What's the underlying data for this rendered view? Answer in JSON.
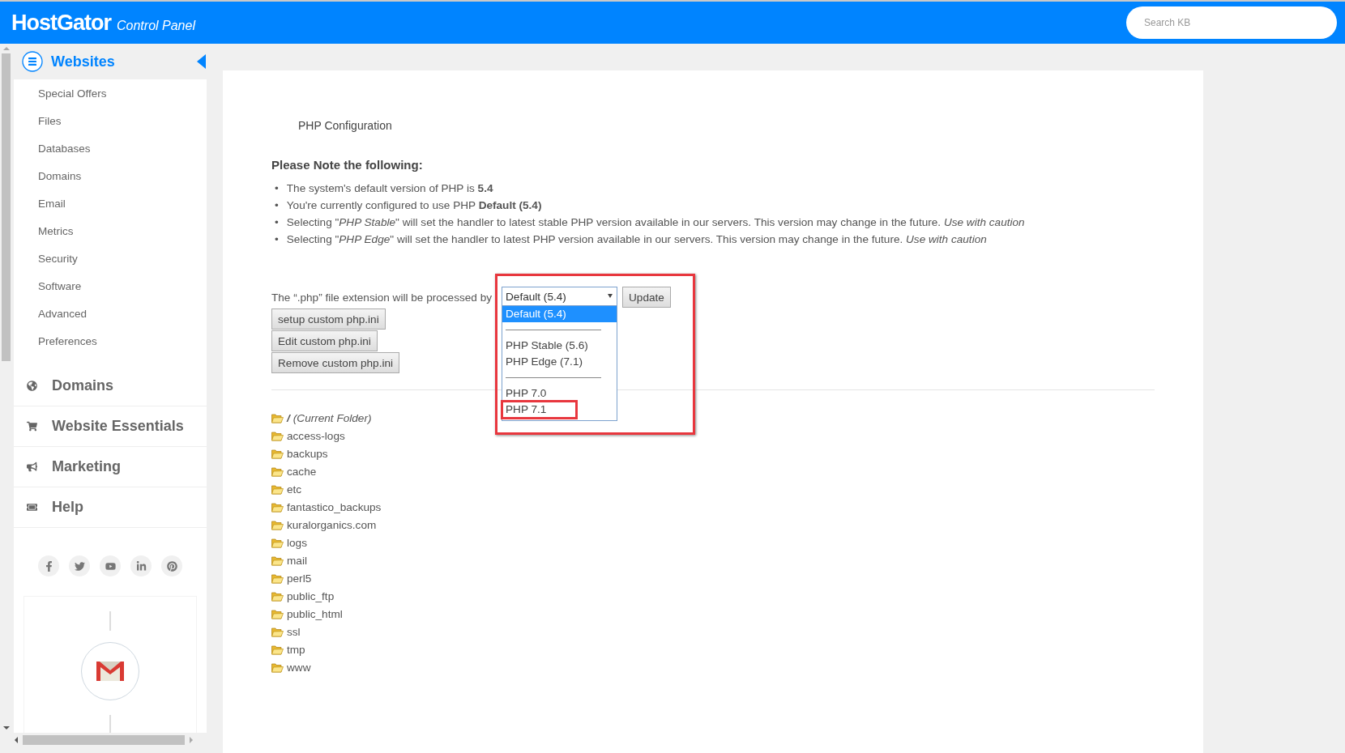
{
  "header": {
    "brand": "HostGator",
    "subtitle": "Control Panel",
    "search": {
      "placeholder": "Search KB"
    }
  },
  "sidebar": {
    "section": {
      "title": "Websites",
      "expanded": true
    },
    "items": [
      "Special Offers",
      "Files",
      "Databases",
      "Domains",
      "Email",
      "Metrics",
      "Security",
      "Software",
      "Advanced",
      "Preferences"
    ],
    "groups": [
      {
        "kind": "globe",
        "label": "Domains"
      },
      {
        "kind": "cart",
        "label": "Website Essentials"
      },
      {
        "kind": "bullhorn",
        "label": "Marketing"
      },
      {
        "kind": "ticket",
        "label": "Help"
      }
    ],
    "social": [
      {
        "kind": "facebook"
      },
      {
        "kind": "twitter"
      },
      {
        "kind": "youtube"
      },
      {
        "kind": "linkedin"
      },
      {
        "kind": "pinterest"
      }
    ]
  },
  "main": {
    "title": "PHP Configuration",
    "note_heading": "Please Note the following:",
    "notes": [
      {
        "bullet": "•",
        "text": "The system's default version of PHP is **5.4**"
      },
      {
        "bullet": "•",
        "text": "You're currently configured to use PHP **Default (5.4)**"
      },
      {
        "bullet": "•",
        "text": "Selecting \"*PHP Stable*\" will set the handler to latest stable PHP version available in our servers. This version may change in the future. *Use with caution*"
      },
      {
        "bullet": "•",
        "text": "Selecting \"*PHP Edge*\" will set the handler to latest PHP version available in our servers. This version may change in the future. *Use with caution*"
      }
    ],
    "handler": {
      "label": "The “.php” file extension will be processed by",
      "value": "Default (5.4)",
      "highlighted": true,
      "expanded": true,
      "options": [
        {
          "kind": "option",
          "label": "Default (5.4)",
          "selected": true,
          "highlighted": false
        },
        {
          "kind": "separator"
        },
        {
          "kind": "option",
          "label": "PHP Stable (5.6)",
          "selected": false,
          "highlighted": false
        },
        {
          "kind": "option",
          "label": "PHP Edge (7.1)",
          "selected": false,
          "highlighted": false
        },
        {
          "kind": "separator"
        },
        {
          "kind": "option",
          "label": "PHP 7.0",
          "selected": false,
          "highlighted": false
        },
        {
          "kind": "option",
          "label": "PHP 7.1",
          "selected": false,
          "highlighted": true
        }
      ],
      "update_button": "Update"
    },
    "buttons": [
      "setup custom php.ini",
      "Edit custom php.ini",
      "Remove custom php.ini"
    ],
    "folders": [
      {
        "name": "/",
        "note": "(Current Folder)"
      },
      {
        "name": "access-logs"
      },
      {
        "name": "backups"
      },
      {
        "name": "cache"
      },
      {
        "name": "etc"
      },
      {
        "name": "fantastico_backups"
      },
      {
        "name": "kuralorganics.com"
      },
      {
        "name": "logs"
      },
      {
        "name": "mail"
      },
      {
        "name": "perl5"
      },
      {
        "name": "public_ftp"
      },
      {
        "name": "public_html"
      },
      {
        "name": "ssl"
      },
      {
        "name": "tmp"
      },
      {
        "name": "www"
      }
    ]
  }
}
